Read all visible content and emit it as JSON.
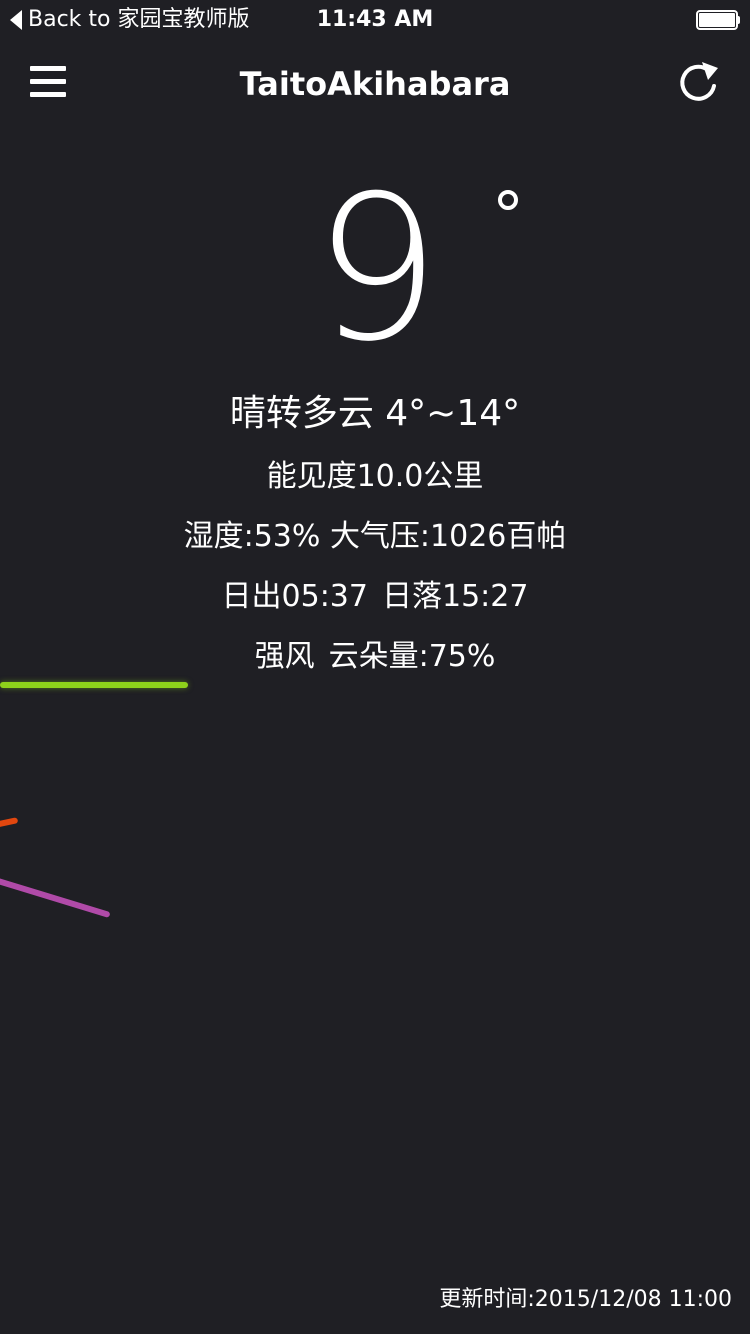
{
  "status_bar": {
    "back_label": "Back to 家园宝教师版",
    "time": "11:43 AM",
    "battery_level": 1.0
  },
  "nav": {
    "title": "TaitoAkihabara",
    "menu_icon": "hamburger-menu-icon",
    "refresh_icon": "refresh-icon"
  },
  "weather": {
    "temperature": "9",
    "condition": "晴转多云 4°~14°",
    "visibility": "能见度10.0公里",
    "humidity": "湿度:53%",
    "pressure": "大气压:1026百帕",
    "sunrise": "日出05:37",
    "sunset": "日落15:27",
    "wind": "强风",
    "cloud": "云朵量:75%"
  },
  "footer": {
    "updated": "更新时间:2015/12/08 11:00"
  },
  "colors": {
    "background": "#1f1f24",
    "text": "#ffffff",
    "streak_green": "#8ed21b",
    "streak_orange": "#e2470f",
    "streak_purple": "#b04aa8"
  }
}
